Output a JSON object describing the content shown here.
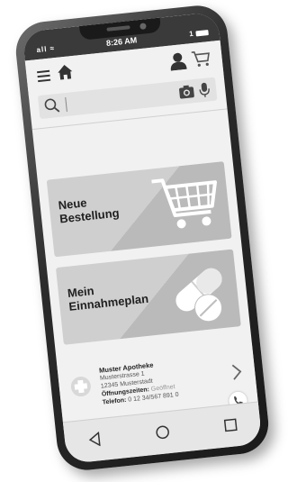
{
  "status_bar": {
    "signal": "all ≈",
    "time": "8:26 AM",
    "battery_label": "1"
  },
  "search": {
    "value": "",
    "placeholder": ""
  },
  "cards": [
    {
      "label_line1": "Neue",
      "label_line2": "Bestellung",
      "icon": "shopping-cart-icon"
    },
    {
      "label_line1": "Mein",
      "label_line2": "Einnahmeplan",
      "icon": "pills-icon"
    }
  ],
  "pharmacy": {
    "name": "Muster Apotheke",
    "street": "Musterstrasse 1",
    "city": "12345 Musterstadt",
    "hours_label": "Öffnungszeiten:",
    "hours_value": "Geöffnet",
    "phone_label": "Telefon:",
    "phone_value": "0 12 34/567 891 0"
  },
  "colors": {
    "frame": "#1a1a1a",
    "statusbar": "#3a3a3a",
    "card": "#cfcfcf",
    "screen": "#f1f1f1"
  }
}
